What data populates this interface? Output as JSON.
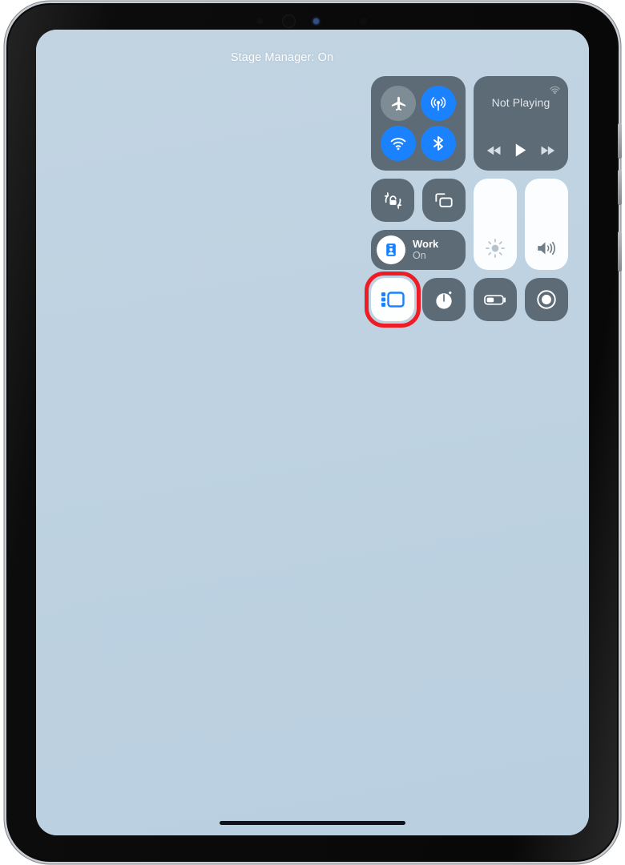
{
  "device": {
    "name": "ipad",
    "camera": [
      "sensor",
      "lens",
      "indicator",
      "sensor-small",
      "lens"
    ],
    "side_buttons": [
      "volume-up",
      "volume-down",
      "power"
    ]
  },
  "screen": {
    "wallpaper_color": "#bed2e1",
    "home_indicator": true
  },
  "status": {
    "stage_manager_banner": "Stage Manager: On"
  },
  "control_center": {
    "connectivity": {
      "module_name": "connectivity",
      "buttons": [
        {
          "name": "airplane-mode",
          "label": "Airplane Mode",
          "state": "Off",
          "on": false
        },
        {
          "name": "airdrop",
          "label": "AirDrop",
          "state": "On",
          "on": true
        },
        {
          "name": "wifi",
          "label": "Wi-Fi",
          "state": "On",
          "on": true
        },
        {
          "name": "bluetooth",
          "label": "Bluetooth",
          "state": "On",
          "on": true
        }
      ]
    },
    "media": {
      "title": "Not Playing",
      "airplay_label": "AirPlay",
      "controls": [
        {
          "name": "rewind",
          "label": "Rewind"
        },
        {
          "name": "play",
          "label": "Play"
        },
        {
          "name": "fast-forward",
          "label": "Fast Forward"
        }
      ]
    },
    "toggles": [
      {
        "name": "rotation-lock",
        "label": "Rotation Lock",
        "state": "Off",
        "on": false
      },
      {
        "name": "screen-mirroring",
        "label": "Screen Mirroring",
        "state": "Off",
        "on": false
      }
    ],
    "focus": {
      "name": "Work",
      "state": "On",
      "icon": "id-badge-icon"
    },
    "sliders": [
      {
        "name": "brightness",
        "label": "Brightness",
        "value": 100
      },
      {
        "name": "volume",
        "label": "Volume",
        "value": 100
      }
    ],
    "bottom_row": [
      {
        "name": "stage-manager",
        "label": "Stage Manager",
        "state": "On",
        "on": true,
        "highlighted": true
      },
      {
        "name": "timer",
        "label": "Timer",
        "state": "Off",
        "on": false,
        "highlighted": false
      },
      {
        "name": "low-power-mode",
        "label": "Low Power Mode",
        "state": "Off",
        "on": false,
        "highlighted": false
      },
      {
        "name": "screen-recording",
        "label": "Screen Recording",
        "state": "Off",
        "on": false,
        "highlighted": false
      }
    ]
  },
  "colors": {
    "accent_blue": "#1a82ff",
    "tile_gray": "#5c6b75",
    "highlight_red": "#ee1c25",
    "active_white": "#fdfefe"
  }
}
